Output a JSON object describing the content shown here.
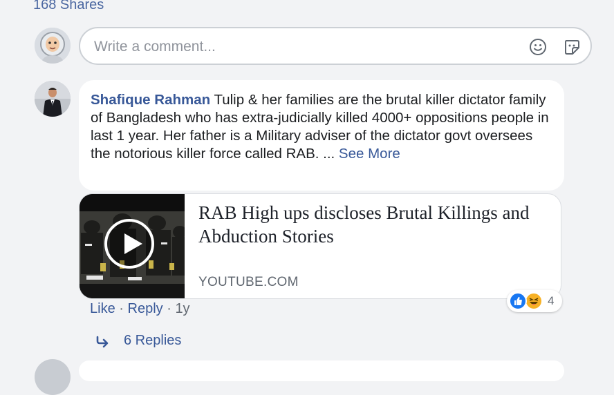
{
  "post": {
    "shares_label": "168 Shares"
  },
  "composer": {
    "placeholder": "Write a comment..."
  },
  "comment": {
    "author": "Shafique Rahman",
    "text": "Tulip & her families are the brutal killer dictator family of Bangladesh who has extra-judicially killed 4000+ oppositions people in last 1 year. Her father is a Military adviser of the dictator govt oversees the notorious killer force called RAB. ...",
    "see_more": "See More",
    "link": {
      "title": "RAB High ups discloses Brutal Killings and Abduction Stories",
      "domain": "YOUTUBE.COM"
    },
    "reactions": {
      "types": [
        "like",
        "haha"
      ],
      "count": "4"
    },
    "actions": {
      "like": "Like",
      "reply": "Reply",
      "time": "1y",
      "sep": "·"
    },
    "replies_label": "6 Replies"
  },
  "icons": {
    "emoji": "smiley-face-icon",
    "sticker": "sticker-icon",
    "play": "play-icon",
    "reply_arrow": "reply-arrow-icon"
  },
  "colors": {
    "link_blue": "#385898",
    "background": "#f2f3f5",
    "like_blue": "#1877f2",
    "haha_yellow": "#f7b125"
  }
}
